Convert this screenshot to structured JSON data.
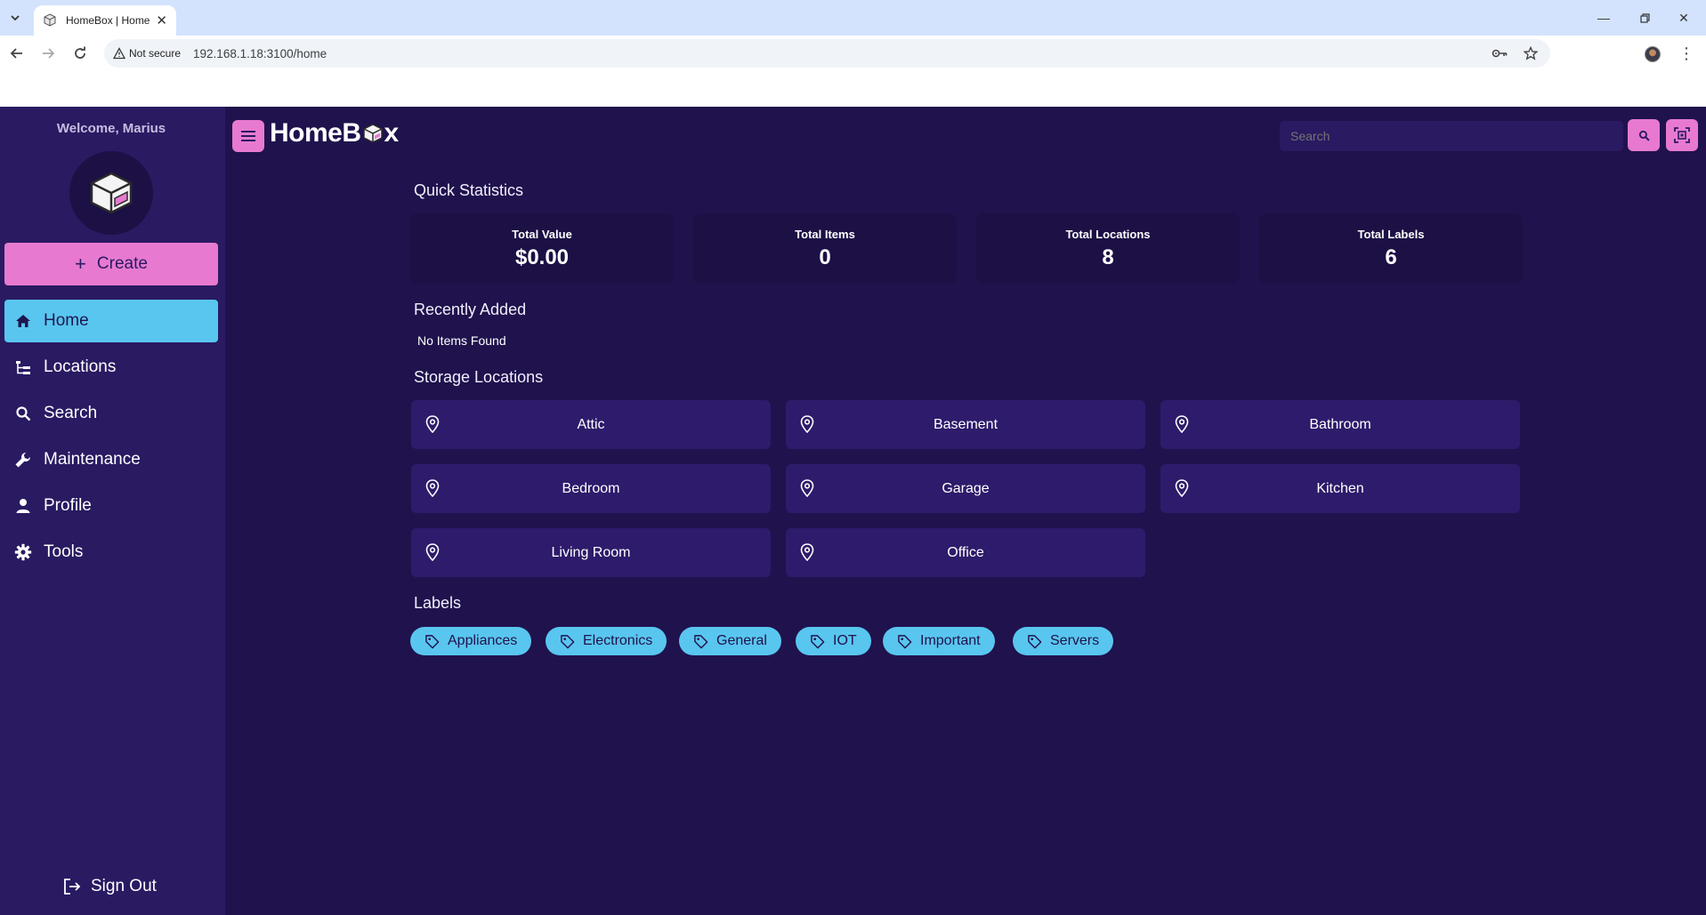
{
  "browser": {
    "tab_title": "HomeBox | Home",
    "security_label": "Not secure",
    "url": "192.168.1.18:3100/home"
  },
  "sidebar": {
    "welcome": "Welcome, Marius",
    "create_label": "Create",
    "nav": [
      {
        "label": "Home",
        "icon": "home-icon",
        "active": true
      },
      {
        "label": "Locations",
        "icon": "tree-icon"
      },
      {
        "label": "Search",
        "icon": "search-icon"
      },
      {
        "label": "Maintenance",
        "icon": "wrench-icon"
      },
      {
        "label": "Profile",
        "icon": "person-icon"
      },
      {
        "label": "Tools",
        "icon": "gear-icon"
      }
    ],
    "signout_label": "Sign Out"
  },
  "header": {
    "brand": {
      "pre": "HomeB",
      "post": "x"
    },
    "search_placeholder": "Search"
  },
  "stats": {
    "title": "Quick Statistics",
    "items": [
      {
        "label": "Total Value",
        "value": "$0.00"
      },
      {
        "label": "Total Items",
        "value": "0"
      },
      {
        "label": "Total Locations",
        "value": "8"
      },
      {
        "label": "Total Labels",
        "value": "6"
      }
    ]
  },
  "recent": {
    "title": "Recently Added",
    "empty": "No Items Found"
  },
  "locations": {
    "title": "Storage Locations",
    "items": [
      "Attic",
      "Basement",
      "Bathroom",
      "Bedroom",
      "Garage",
      "Kitchen",
      "Living Room",
      "Office"
    ]
  },
  "labels": {
    "title": "Labels",
    "items": [
      "Appliances",
      "Electronics",
      "General",
      "IOT",
      "Important",
      "Servers"
    ]
  },
  "colors": {
    "primary_pink": "#e77ad0",
    "accent_blue": "#59c6ef",
    "background": "#20124d",
    "sidebar": "#2a1a62",
    "card": "#2e1b6b"
  }
}
